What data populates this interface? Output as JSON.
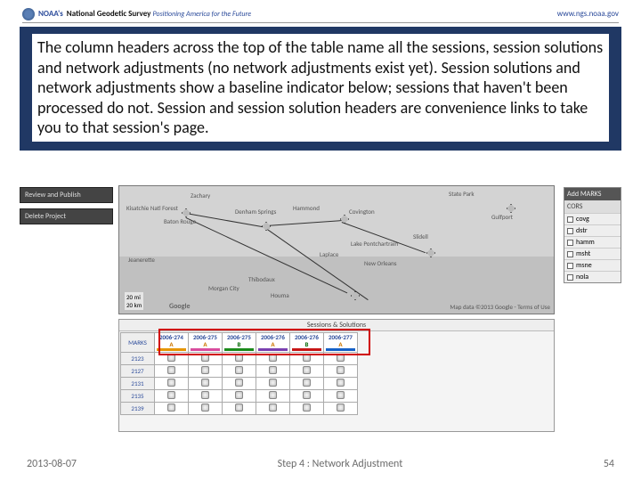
{
  "header": {
    "noaas": "NOAA's",
    "title_bold": "National Geodetic Survey",
    "title_italic": "Positioning America for the Future",
    "url": "www.ngs.noaa.gov"
  },
  "callout": "The column headers across the top of the table name all the sessions, session solutions and network adjustments (no network adjustments exist yet). Session solutions and network adjustments show a baseline indicator below; sessions that haven't been processed do not. Session and session solution headers are convenience links to take you to that session's page.",
  "sidebar_left": {
    "review": "Review and Publish",
    "delete": "Delete Project"
  },
  "map": {
    "labels": {
      "zachary": "Zachary",
      "batonrouge": "Baton Rouge",
      "denham": "Denham Springs",
      "hammond": "Hammond",
      "covington": "Covington",
      "laplace": "Laplace",
      "neworleans": "New Orleans",
      "morgan": "Morgan City",
      "houma": "Houma",
      "thibodaux": "Thibodaux",
      "gulfport": "Gulfport",
      "slidell": "Slidell",
      "lake": "Lake Pontchartrain",
      "jeanerette": "Jeanerette",
      "statepark": "State Park",
      "kisatchie": "Kisatchie Natl Forest"
    },
    "scale1": "20 mi",
    "scale2": "20 km",
    "google": "Google",
    "credit": "Map data ©2013 Google - Terms of Use"
  },
  "right": {
    "add": "Add MARKS",
    "cors": "CORS",
    "items": [
      "covg",
      "dstr",
      "hamm",
      "msht",
      "msne",
      "nola"
    ]
  },
  "sessions": {
    "title": "Sessions & Solutions",
    "marks_header": "MARKS",
    "cols": [
      {
        "yr": "2006-274",
        "ltr": "A",
        "cls": "A",
        "bar": "c1"
      },
      {
        "yr": "2006-275",
        "ltr": "A",
        "cls": "A",
        "bar": "c2"
      },
      {
        "yr": "2006-275",
        "ltr": "B",
        "cls": "B",
        "bar": "c3"
      },
      {
        "yr": "2006-276",
        "ltr": "A",
        "cls": "A",
        "bar": "c4"
      },
      {
        "yr": "2006-276",
        "ltr": "B",
        "cls": "B",
        "bar": "c5"
      },
      {
        "yr": "2006-277",
        "ltr": "A",
        "cls": "A",
        "bar": "c6"
      }
    ],
    "marks": [
      "2123",
      "2127",
      "2131",
      "2135",
      "2139"
    ]
  },
  "footer": {
    "date": "2013-08-07",
    "step": "Step 4 : Network Adjustment",
    "page": "54"
  }
}
